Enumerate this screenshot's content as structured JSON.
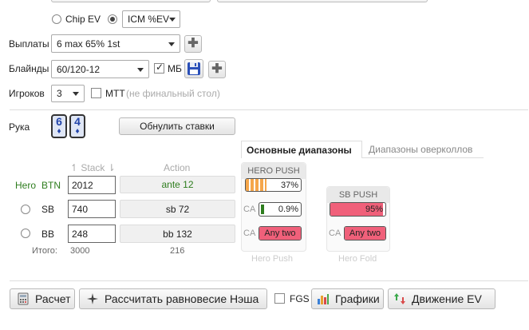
{
  "ev_mode": {
    "chip_ev": "Chip EV",
    "icm": "ICM %EV"
  },
  "payouts": {
    "label": "Выплаты",
    "value": "6 max 65% 1st"
  },
  "blinds": {
    "label": "Блайнды",
    "value": "60/120-12",
    "mb_label": "МБ"
  },
  "players": {
    "label": "Игроков",
    "value": "3",
    "mtt_label": "MTT",
    "mtt_note": "(не финальный стол)"
  },
  "hand": {
    "label": "Рука",
    "cards": [
      {
        "rank": "6",
        "suit": "♦"
      },
      {
        "rank": "4",
        "suit": "♦"
      }
    ],
    "reset_button": "Обнулить ставки"
  },
  "tabs": {
    "main": "Основные диапазоны",
    "overcall": "Диапазоны оверколлов"
  },
  "table": {
    "stack_header": "Stack",
    "action_header": "Action",
    "rows": [
      {
        "name": "Hero",
        "position": "BTN",
        "stack": "2012",
        "action": "ante 12"
      },
      {
        "name": "",
        "position": "SB",
        "stack": "740",
        "action": "sb 72"
      },
      {
        "name": "",
        "position": "BB",
        "stack": "248",
        "action": "bb 132"
      }
    ],
    "total_label": "Итого:",
    "total_stack": "3000",
    "total_action": "216"
  },
  "hero_push": {
    "title": "HERO PUSH",
    "footer": "Hero Push",
    "ca_label": "CA",
    "push_pct": "37%",
    "push_value": 0.37,
    "sb_ca": "0.9%",
    "sb_ca_value": 0.009,
    "bb_ca": "Any two"
  },
  "sb_push": {
    "title": "SB PUSH",
    "footer": "Hero Fold",
    "ca_label": "CA",
    "push_pct": "95%",
    "push_value": 0.95,
    "bb_ca": "Any two"
  },
  "toolbar": {
    "calc": "Расчет",
    "nash": "Рассчитать равновесие Нэша",
    "fgs": "FGS",
    "charts": "Графики",
    "ev_move": "Движение EV"
  },
  "colors": {
    "accent_green": "#2e7d1e",
    "red_bar": "#f0607a",
    "orange_bar": "#f5a64a"
  }
}
